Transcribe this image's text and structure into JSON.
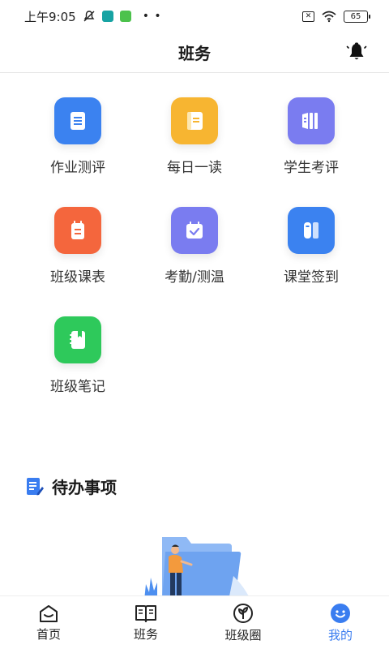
{
  "status_bar": {
    "time": "上午9:05",
    "battery": "65"
  },
  "header": {
    "title": "班务"
  },
  "grid": {
    "items": [
      {
        "label": "作业测评",
        "icon": "homework-icon",
        "color": "#3b82f0"
      },
      {
        "label": "每日一读",
        "icon": "daily-read-icon",
        "color": "#f7b531"
      },
      {
        "label": "学生考评",
        "icon": "student-eval-icon",
        "color": "#7a7cf0"
      },
      {
        "label": "班级课表",
        "icon": "class-schedule-icon",
        "color": "#f4663d"
      },
      {
        "label": "考勤/测温",
        "icon": "attendance-icon",
        "color": "#7a7cf0"
      },
      {
        "label": "课堂签到",
        "icon": "class-checkin-icon",
        "color": "#3b82f0"
      },
      {
        "label": "班级笔记",
        "icon": "class-notes-icon",
        "color": "#2ec95b"
      }
    ]
  },
  "todo": {
    "title": "待办事项"
  },
  "tabbar": {
    "items": [
      {
        "label": "首页",
        "icon": "home-icon",
        "active": false
      },
      {
        "label": "班务",
        "icon": "book-icon",
        "active": false
      },
      {
        "label": "班级圈",
        "icon": "class-circle-icon",
        "active": false
      },
      {
        "label": "我的",
        "icon": "profile-icon",
        "active": true
      }
    ],
    "active_color": "#3a7df0"
  }
}
